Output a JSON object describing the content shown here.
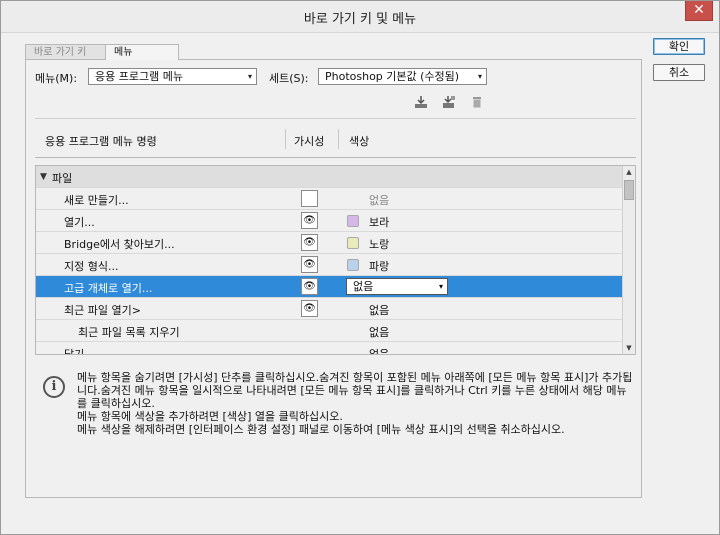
{
  "window": {
    "title": "바로 가기 키 및 메뉴",
    "close_glyph": "✕"
  },
  "tabs": [
    {
      "label": "바로 가기 키",
      "active": false
    },
    {
      "label": "메뉴",
      "active": true
    }
  ],
  "buttons": {
    "ok": "확인",
    "cancel": "취소"
  },
  "controls": {
    "menu_label": "메뉴(M):",
    "menu_value": "응용 프로그램 메뉴",
    "set_label": "세트(S):",
    "set_value": "Photoshop 기본값 (수정됨)"
  },
  "toolbar_icons": [
    "save-set-icon",
    "save-as-new-set-icon",
    "delete-set-icon"
  ],
  "table": {
    "columns": {
      "name": "응용 프로그램 메뉴 명령",
      "visibility": "가시성",
      "color": "색상"
    },
    "rows": [
      {
        "type": "group",
        "name": "파일",
        "expanded": true
      },
      {
        "type": "item",
        "name": "새로 만들기...",
        "visible": false,
        "color": "없음",
        "swatch": null
      },
      {
        "type": "item",
        "name": "열기...",
        "visible": true,
        "color": "보라",
        "swatch": "#d6b7ea"
      },
      {
        "type": "item",
        "name": "Bridge에서 찾아보기...",
        "visible": true,
        "color": "노랑",
        "swatch": "#e9ebbb"
      },
      {
        "type": "item",
        "name": "지정 형식...",
        "visible": true,
        "color": "파랑",
        "swatch": "#b9d1ea"
      },
      {
        "type": "item",
        "name": "고급 개체로 열기...",
        "visible": true,
        "color": "없음",
        "selected": true
      },
      {
        "type": "item",
        "name": "최근 파일 열기>",
        "visible": true,
        "color": "없음"
      },
      {
        "type": "subitem",
        "name": "최근 파일 목록 지우기",
        "visible": null,
        "color": "없음"
      },
      {
        "type": "item",
        "name": "닫기",
        "visible": null,
        "color": "없음"
      }
    ]
  },
  "info": {
    "lines": [
      "메뉴 항목을 숨기려면 [가시성] 단추를 클릭하십시오.숨겨진 항목이 포함된 메뉴 아래쪽에 [모든 메뉴 항목 표시]가 추가됩니다.숨겨진 메뉴 항목을 일시적으로 나타내려면 [모든 메뉴 항목 표시]를 클릭하거나 Ctrl 키를 누른 상태에서 해당 메뉴를 클릭하십시오.",
      "메뉴 항목에 색상을 추가하려면 [색상] 열을 클릭하십시오.",
      "메뉴 색상을 해제하려면 [인터페이스 환경 설정] 패널로 이동하여 [메뉴 색상 표시]의 선택을 취소하십시오."
    ]
  },
  "glyphs": {
    "eye": "👁",
    "dropdown_arrow": "▾",
    "expander": "▼",
    "scroll_up": "▲",
    "scroll_down": "▼",
    "info": "i"
  }
}
